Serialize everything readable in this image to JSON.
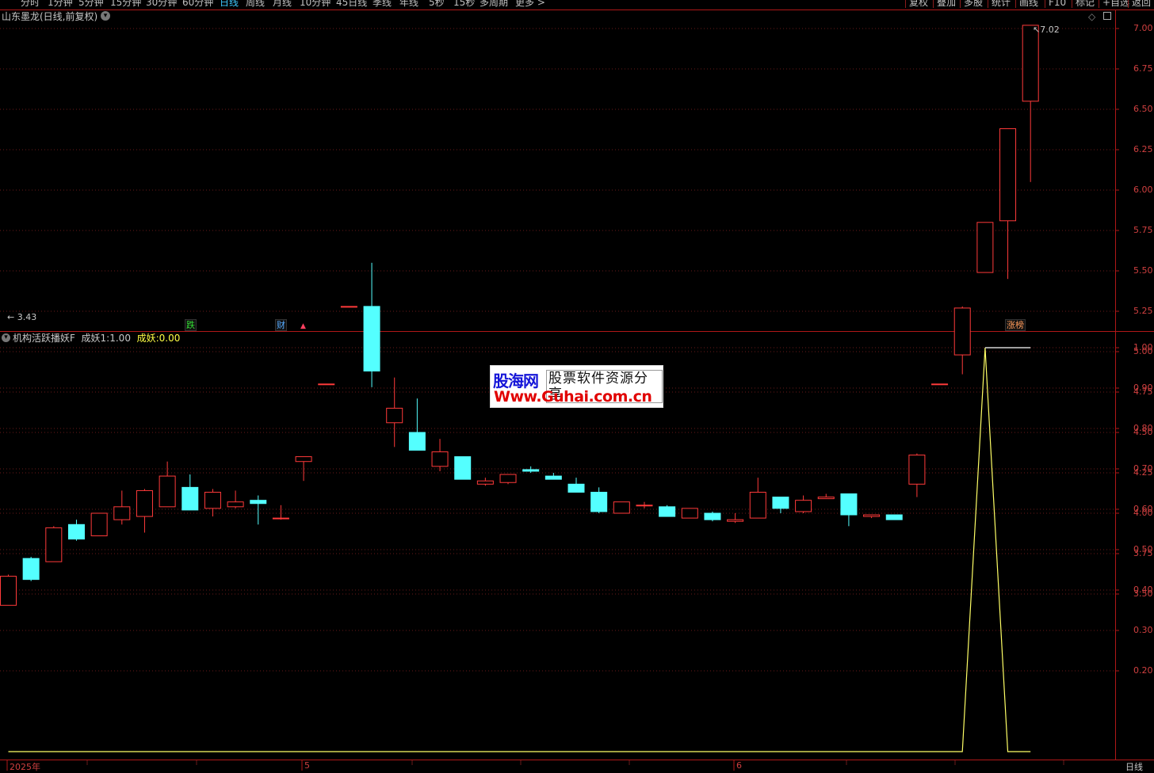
{
  "toolbar": {
    "periods": [
      {
        "label": "分时",
        "x": 26
      },
      {
        "label": "1分钟",
        "x": 60
      },
      {
        "label": "5分钟",
        "x": 99
      },
      {
        "label": "15分钟",
        "x": 139
      },
      {
        "label": "30分钟",
        "x": 184
      },
      {
        "label": "60分钟",
        "x": 230
      },
      {
        "label": "日线",
        "x": 277
      },
      {
        "label": "周线",
        "x": 310
      },
      {
        "label": "月线",
        "x": 344
      },
      {
        "label": "10分钟",
        "x": 378
      },
      {
        "label": "45日线",
        "x": 424
      },
      {
        "label": "季线",
        "x": 470
      },
      {
        "label": "年线",
        "x": 504
      },
      {
        "label": "5秒",
        "x": 541
      },
      {
        "label": "15秒",
        "x": 572
      },
      {
        "label": "多周期",
        "x": 605
      },
      {
        "label": "更多 >",
        "x": 650
      }
    ],
    "active_period": "日线",
    "right_buttons": [
      {
        "label": "复权",
        "x": 1142
      },
      {
        "label": "叠加",
        "x": 1177
      },
      {
        "label": "多股",
        "x": 1211
      },
      {
        "label": "统计",
        "x": 1246
      },
      {
        "label": "画线",
        "x": 1281
      },
      {
        "label": "F10",
        "x": 1318
      },
      {
        "label": "标记",
        "x": 1352
      },
      {
        "label": "+自选",
        "x": 1386
      },
      {
        "label": "返回",
        "x": 1423
      }
    ]
  },
  "main_chart": {
    "title": "山东墨龙(日线,前复权)",
    "min_label": "3.43",
    "max_label": "7.02",
    "price_axis": [
      "7.00",
      "6.75",
      "6.50",
      "6.25",
      "6.00",
      "5.75",
      "5.50",
      "5.25",
      "5.00",
      "4.75",
      "4.50",
      "4.25",
      "4.00",
      "3.75",
      "3.50"
    ],
    "badges": [
      {
        "text": "跌",
        "color": "#33dd33",
        "x": 233
      },
      {
        "text": "财",
        "color": "#55aaff",
        "x": 347
      },
      {
        "text": "涨榜",
        "color": "#ff9a5a",
        "x": 1268
      }
    ],
    "up_color": "#ff3a3a",
    "down_color": "#54ffff"
  },
  "chart_data": [
    {
      "type": "candlestick",
      "title": "山东墨龙(日线,前复权)",
      "ylim": [
        3.35,
        7.05
      ],
      "candles": [
        {
          "o": 3.43,
          "h": 3.62,
          "l": 3.43,
          "c": 3.61
        },
        {
          "o": 3.72,
          "h": 3.73,
          "l": 3.58,
          "c": 3.59
        },
        {
          "o": 3.7,
          "h": 3.92,
          "l": 3.7,
          "c": 3.91
        },
        {
          "o": 3.93,
          "h": 3.96,
          "l": 3.83,
          "c": 3.84
        },
        {
          "o": 3.86,
          "h": 4.0,
          "l": 3.86,
          "c": 4.0
        },
        {
          "o": 3.96,
          "h": 4.14,
          "l": 3.93,
          "c": 4.04
        },
        {
          "o": 3.98,
          "h": 4.15,
          "l": 3.88,
          "c": 4.14
        },
        {
          "o": 4.04,
          "h": 4.32,
          "l": 4.04,
          "c": 4.23
        },
        {
          "o": 4.16,
          "h": 4.24,
          "l": 4.02,
          "c": 4.02
        },
        {
          "o": 4.03,
          "h": 4.15,
          "l": 3.98,
          "c": 4.13
        },
        {
          "o": 4.04,
          "h": 4.14,
          "l": 4.03,
          "c": 4.07
        },
        {
          "o": 4.08,
          "h": 4.11,
          "l": 3.93,
          "c": 4.06
        },
        {
          "o": 3.97,
          "h": 4.05,
          "l": 3.96,
          "c": 3.97
        },
        {
          "o": 4.32,
          "h": 4.35,
          "l": 4.2,
          "c": 4.35
        },
        {
          "o": 4.8,
          "h": 4.8,
          "l": 4.8,
          "c": 4.8
        },
        {
          "o": 5.28,
          "h": 5.28,
          "l": 5.28,
          "c": 5.28
        },
        {
          "o": 5.28,
          "h": 5.55,
          "l": 4.78,
          "c": 4.88
        },
        {
          "o": 4.56,
          "h": 4.84,
          "l": 4.41,
          "c": 4.65
        },
        {
          "o": 4.5,
          "h": 4.71,
          "l": 4.4,
          "c": 4.39
        },
        {
          "o": 4.29,
          "h": 4.46,
          "l": 4.26,
          "c": 4.38
        },
        {
          "o": 4.35,
          "h": 4.35,
          "l": 4.21,
          "c": 4.21
        },
        {
          "o": 4.18,
          "h": 4.22,
          "l": 4.17,
          "c": 4.2
        },
        {
          "o": 4.19,
          "h": 4.24,
          "l": 4.18,
          "c": 4.24
        },
        {
          "o": 4.27,
          "h": 4.29,
          "l": 4.25,
          "c": 4.26
        },
        {
          "o": 4.23,
          "h": 4.25,
          "l": 4.21,
          "c": 4.21
        },
        {
          "o": 4.18,
          "h": 4.22,
          "l": 4.13,
          "c": 4.13
        },
        {
          "o": 4.13,
          "h": 4.16,
          "l": 4.0,
          "c": 4.01
        },
        {
          "o": 4.0,
          "h": 4.07,
          "l": 4.0,
          "c": 4.07
        },
        {
          "o": 4.05,
          "h": 4.07,
          "l": 4.03,
          "c": 4.05
        },
        {
          "o": 4.04,
          "h": 4.05,
          "l": 3.98,
          "c": 3.98
        },
        {
          "o": 3.97,
          "h": 4.03,
          "l": 3.97,
          "c": 4.03
        },
        {
          "o": 4.0,
          "h": 4.01,
          "l": 3.95,
          "c": 3.96
        },
        {
          "o": 3.95,
          "h": 4.0,
          "l": 3.94,
          "c": 3.96
        },
        {
          "o": 3.97,
          "h": 4.22,
          "l": 3.97,
          "c": 4.13
        },
        {
          "o": 4.1,
          "h": 4.1,
          "l": 4.0,
          "c": 4.03
        },
        {
          "o": 4.01,
          "h": 4.11,
          "l": 4.0,
          "c": 4.08
        },
        {
          "o": 4.09,
          "h": 4.12,
          "l": 4.09,
          "c": 4.1
        },
        {
          "o": 4.12,
          "h": 4.12,
          "l": 3.92,
          "c": 3.99
        },
        {
          "o": 3.98,
          "h": 3.99,
          "l": 3.97,
          "c": 3.99
        },
        {
          "o": 3.99,
          "h": 3.99,
          "l": 3.96,
          "c": 3.96
        },
        {
          "o": 4.18,
          "h": 4.37,
          "l": 4.1,
          "c": 4.36
        },
        {
          "o": 4.8,
          "h": 4.8,
          "l": 4.8,
          "c": 4.8
        },
        {
          "o": 4.98,
          "h": 5.28,
          "l": 4.86,
          "c": 5.27
        },
        {
          "o": 5.49,
          "h": 5.8,
          "l": 5.49,
          "c": 5.8
        },
        {
          "o": 5.81,
          "h": 6.38,
          "l": 5.45,
          "c": 6.38
        },
        {
          "o": 6.55,
          "h": 7.02,
          "l": 6.05,
          "c": 7.02
        }
      ]
    },
    {
      "type": "line",
      "title": "机构活跃播妖F",
      "ylim": [
        0,
        1.0
      ],
      "series": [
        {
          "name": "成妖1",
          "color": "#ffff66",
          "values": [
            0,
            0,
            0,
            0,
            0,
            0,
            0,
            0,
            0,
            0,
            0,
            0,
            0,
            0,
            0,
            0,
            0,
            0,
            0,
            0,
            0,
            0,
            0,
            0,
            0,
            0,
            0,
            0,
            0,
            0,
            0,
            0,
            0,
            0,
            0,
            0,
            0,
            0,
            0,
            0,
            0,
            0,
            0,
            1,
            0,
            0
          ]
        },
        {
          "name": "成妖",
          "color": "#ffffff",
          "values": [
            null,
            null,
            null,
            null,
            null,
            null,
            null,
            null,
            null,
            null,
            null,
            null,
            null,
            null,
            null,
            null,
            null,
            null,
            null,
            null,
            null,
            null,
            null,
            null,
            null,
            null,
            null,
            null,
            null,
            null,
            null,
            null,
            null,
            null,
            null,
            null,
            null,
            null,
            null,
            null,
            null,
            null,
            null,
            1,
            1,
            1
          ]
        }
      ]
    }
  ],
  "indicator": {
    "name": "机构活跃播妖F",
    "legend1_label": "成妖1:",
    "legend1_value": "1.00",
    "legend2_label": "成妖:",
    "legend2_value": "0.00",
    "axis": [
      "1.00",
      "0.90",
      "0.80",
      "0.70",
      "0.60",
      "0.50",
      "0.40",
      "0.30",
      "0.20"
    ]
  },
  "time_axis": [
    {
      "label": "2025年",
      "x": 12
    },
    {
      "label": "5",
      "x": 384
    },
    {
      "label": "6",
      "x": 929
    }
  ],
  "period_label": "日线",
  "watermark": {
    "logo": "股海网",
    "slogan": "股票软件资源分享",
    "url": "Www.Guhai.com.cn"
  }
}
